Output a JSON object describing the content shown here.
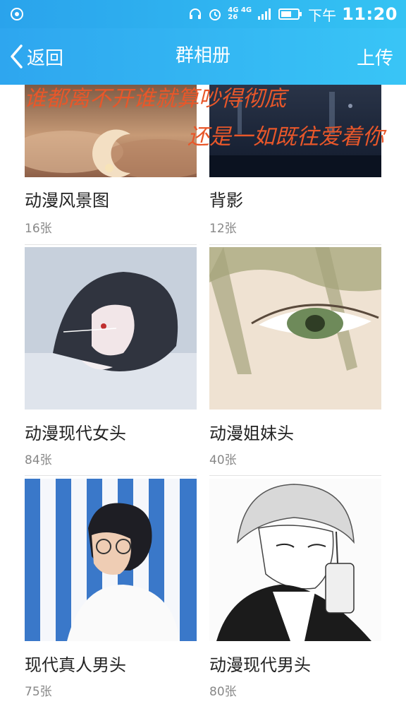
{
  "status_bar": {
    "network_top": "4G 4G",
    "network_bottom": "26",
    "period": "下午",
    "time": "11:20",
    "icons": [
      "app-notification-icon",
      "headphones-icon",
      "alarm-icon",
      "signal-icon",
      "battery-icon"
    ]
  },
  "nav": {
    "back_label": "返回",
    "title": "群相册",
    "upload_label": "上传"
  },
  "banner": {
    "line1": "谁都离不开谁就算吵得彻底",
    "line2": "还是一如既往爱着你"
  },
  "albums": [
    {
      "name": "动漫风景图",
      "count": "16张"
    },
    {
      "name": "背影",
      "count": "12张"
    },
    {
      "name": "动漫现代女头",
      "count": "84张"
    },
    {
      "name": "动漫姐妹头",
      "count": "40张"
    },
    {
      "name": "现代真人男头",
      "count": "75张"
    },
    {
      "name": "动漫现代男头",
      "count": "80张"
    }
  ],
  "colors": {
    "header_start": "#2ea6ef",
    "header_end": "#39c5f6",
    "banner_text": "#e8572a"
  }
}
